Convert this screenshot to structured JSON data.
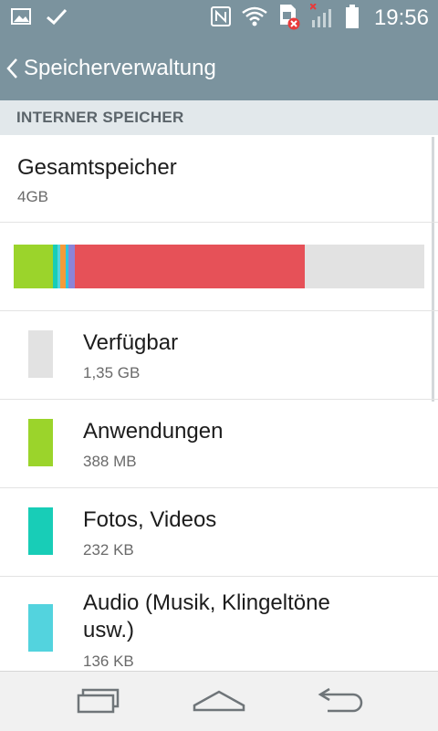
{
  "status_bar": {
    "time": "19:56",
    "icons": [
      "image-icon",
      "check-icon",
      "nfc-icon",
      "wifi-icon",
      "sim-error-icon",
      "no-signal-icon",
      "battery-icon"
    ]
  },
  "header": {
    "title": "Speicherverwaltung"
  },
  "section": {
    "label": "INTERNER SPEICHER"
  },
  "total": {
    "label": "Gesamtspeicher",
    "value": "4GB"
  },
  "usage_bar": {
    "segments": [
      {
        "color": "#9bd42b",
        "fraction": 0.095
      },
      {
        "color": "#18cdb7",
        "fraction": 0.011
      },
      {
        "color": "#53d3de",
        "fraction": 0.008
      },
      {
        "color": "#f59b3a",
        "fraction": 0.013
      },
      {
        "color": "#2dc7e0",
        "fraction": 0.007
      },
      {
        "color": "#8c84d8",
        "fraction": 0.016
      },
      {
        "color": "#e65158",
        "fraction": 0.56
      }
    ],
    "free_color": "#e2e2e2"
  },
  "items": [
    {
      "label": "Verfügbar",
      "value": "1,35 GB",
      "color": "#e2e2e2"
    },
    {
      "label": "Anwendungen",
      "value": "388 MB",
      "color": "#9bd42b"
    },
    {
      "label": "Fotos, Videos",
      "value": "232 KB",
      "color": "#18cdb7"
    },
    {
      "label": "Audio (Musik, Klingeltöne usw.)",
      "value": "136 KB",
      "color": "#53d3de"
    }
  ],
  "nav": {
    "icons": [
      "recent-apps-icon",
      "home-icon",
      "back-icon"
    ]
  }
}
